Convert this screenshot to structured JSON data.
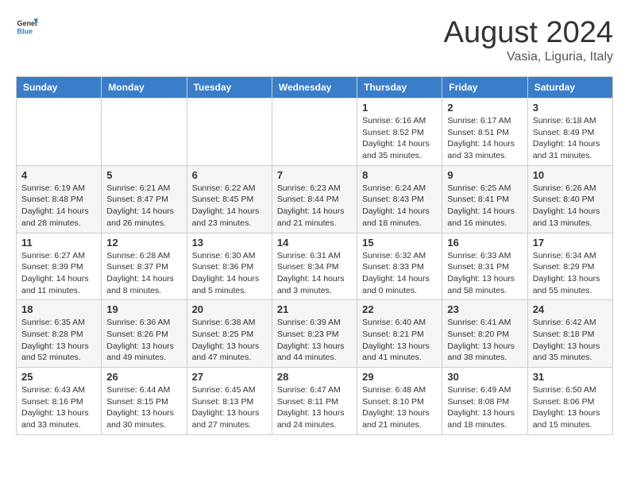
{
  "header": {
    "logo_general": "General",
    "logo_blue": "Blue",
    "month_year": "August 2024",
    "location": "Vasia, Liguria, Italy"
  },
  "days_of_week": [
    "Sunday",
    "Monday",
    "Tuesday",
    "Wednesday",
    "Thursday",
    "Friday",
    "Saturday"
  ],
  "weeks": [
    [
      {
        "day": "",
        "sunrise": "",
        "sunset": "",
        "daylight": ""
      },
      {
        "day": "",
        "sunrise": "",
        "sunset": "",
        "daylight": ""
      },
      {
        "day": "",
        "sunrise": "",
        "sunset": "",
        "daylight": ""
      },
      {
        "day": "",
        "sunrise": "",
        "sunset": "",
        "daylight": ""
      },
      {
        "day": "1",
        "sunrise": "Sunrise: 6:16 AM",
        "sunset": "Sunset: 8:52 PM",
        "daylight": "Daylight: 14 hours and 35 minutes."
      },
      {
        "day": "2",
        "sunrise": "Sunrise: 6:17 AM",
        "sunset": "Sunset: 8:51 PM",
        "daylight": "Daylight: 14 hours and 33 minutes."
      },
      {
        "day": "3",
        "sunrise": "Sunrise: 6:18 AM",
        "sunset": "Sunset: 8:49 PM",
        "daylight": "Daylight: 14 hours and 31 minutes."
      }
    ],
    [
      {
        "day": "4",
        "sunrise": "Sunrise: 6:19 AM",
        "sunset": "Sunset: 8:48 PM",
        "daylight": "Daylight: 14 hours and 28 minutes."
      },
      {
        "day": "5",
        "sunrise": "Sunrise: 6:21 AM",
        "sunset": "Sunset: 8:47 PM",
        "daylight": "Daylight: 14 hours and 26 minutes."
      },
      {
        "day": "6",
        "sunrise": "Sunrise: 6:22 AM",
        "sunset": "Sunset: 8:45 PM",
        "daylight": "Daylight: 14 hours and 23 minutes."
      },
      {
        "day": "7",
        "sunrise": "Sunrise: 6:23 AM",
        "sunset": "Sunset: 8:44 PM",
        "daylight": "Daylight: 14 hours and 21 minutes."
      },
      {
        "day": "8",
        "sunrise": "Sunrise: 6:24 AM",
        "sunset": "Sunset: 8:43 PM",
        "daylight": "Daylight: 14 hours and 18 minutes."
      },
      {
        "day": "9",
        "sunrise": "Sunrise: 6:25 AM",
        "sunset": "Sunset: 8:41 PM",
        "daylight": "Daylight: 14 hours and 16 minutes."
      },
      {
        "day": "10",
        "sunrise": "Sunrise: 6:26 AM",
        "sunset": "Sunset: 8:40 PM",
        "daylight": "Daylight: 14 hours and 13 minutes."
      }
    ],
    [
      {
        "day": "11",
        "sunrise": "Sunrise: 6:27 AM",
        "sunset": "Sunset: 8:39 PM",
        "daylight": "Daylight: 14 hours and 11 minutes."
      },
      {
        "day": "12",
        "sunrise": "Sunrise: 6:28 AM",
        "sunset": "Sunset: 8:37 PM",
        "daylight": "Daylight: 14 hours and 8 minutes."
      },
      {
        "day": "13",
        "sunrise": "Sunrise: 6:30 AM",
        "sunset": "Sunset: 8:36 PM",
        "daylight": "Daylight: 14 hours and 5 minutes."
      },
      {
        "day": "14",
        "sunrise": "Sunrise: 6:31 AM",
        "sunset": "Sunset: 8:34 PM",
        "daylight": "Daylight: 14 hours and 3 minutes."
      },
      {
        "day": "15",
        "sunrise": "Sunrise: 6:32 AM",
        "sunset": "Sunset: 8:33 PM",
        "daylight": "Daylight: 14 hours and 0 minutes."
      },
      {
        "day": "16",
        "sunrise": "Sunrise: 6:33 AM",
        "sunset": "Sunset: 8:31 PM",
        "daylight": "Daylight: 13 hours and 58 minutes."
      },
      {
        "day": "17",
        "sunrise": "Sunrise: 6:34 AM",
        "sunset": "Sunset: 8:29 PM",
        "daylight": "Daylight: 13 hours and 55 minutes."
      }
    ],
    [
      {
        "day": "18",
        "sunrise": "Sunrise: 6:35 AM",
        "sunset": "Sunset: 8:28 PM",
        "daylight": "Daylight: 13 hours and 52 minutes."
      },
      {
        "day": "19",
        "sunrise": "Sunrise: 6:36 AM",
        "sunset": "Sunset: 8:26 PM",
        "daylight": "Daylight: 13 hours and 49 minutes."
      },
      {
        "day": "20",
        "sunrise": "Sunrise: 6:38 AM",
        "sunset": "Sunset: 8:25 PM",
        "daylight": "Daylight: 13 hours and 47 minutes."
      },
      {
        "day": "21",
        "sunrise": "Sunrise: 6:39 AM",
        "sunset": "Sunset: 8:23 PM",
        "daylight": "Daylight: 13 hours and 44 minutes."
      },
      {
        "day": "22",
        "sunrise": "Sunrise: 6:40 AM",
        "sunset": "Sunset: 8:21 PM",
        "daylight": "Daylight: 13 hours and 41 minutes."
      },
      {
        "day": "23",
        "sunrise": "Sunrise: 6:41 AM",
        "sunset": "Sunset: 8:20 PM",
        "daylight": "Daylight: 13 hours and 38 minutes."
      },
      {
        "day": "24",
        "sunrise": "Sunrise: 6:42 AM",
        "sunset": "Sunset: 8:18 PM",
        "daylight": "Daylight: 13 hours and 35 minutes."
      }
    ],
    [
      {
        "day": "25",
        "sunrise": "Sunrise: 6:43 AM",
        "sunset": "Sunset: 8:16 PM",
        "daylight": "Daylight: 13 hours and 33 minutes."
      },
      {
        "day": "26",
        "sunrise": "Sunrise: 6:44 AM",
        "sunset": "Sunset: 8:15 PM",
        "daylight": "Daylight: 13 hours and 30 minutes."
      },
      {
        "day": "27",
        "sunrise": "Sunrise: 6:45 AM",
        "sunset": "Sunset: 8:13 PM",
        "daylight": "Daylight: 13 hours and 27 minutes."
      },
      {
        "day": "28",
        "sunrise": "Sunrise: 6:47 AM",
        "sunset": "Sunset: 8:11 PM",
        "daylight": "Daylight: 13 hours and 24 minutes."
      },
      {
        "day": "29",
        "sunrise": "Sunrise: 6:48 AM",
        "sunset": "Sunset: 8:10 PM",
        "daylight": "Daylight: 13 hours and 21 minutes."
      },
      {
        "day": "30",
        "sunrise": "Sunrise: 6:49 AM",
        "sunset": "Sunset: 8:08 PM",
        "daylight": "Daylight: 13 hours and 18 minutes."
      },
      {
        "day": "31",
        "sunrise": "Sunrise: 6:50 AM",
        "sunset": "Sunset: 8:06 PM",
        "daylight": "Daylight: 13 hours and 15 minutes."
      }
    ]
  ]
}
